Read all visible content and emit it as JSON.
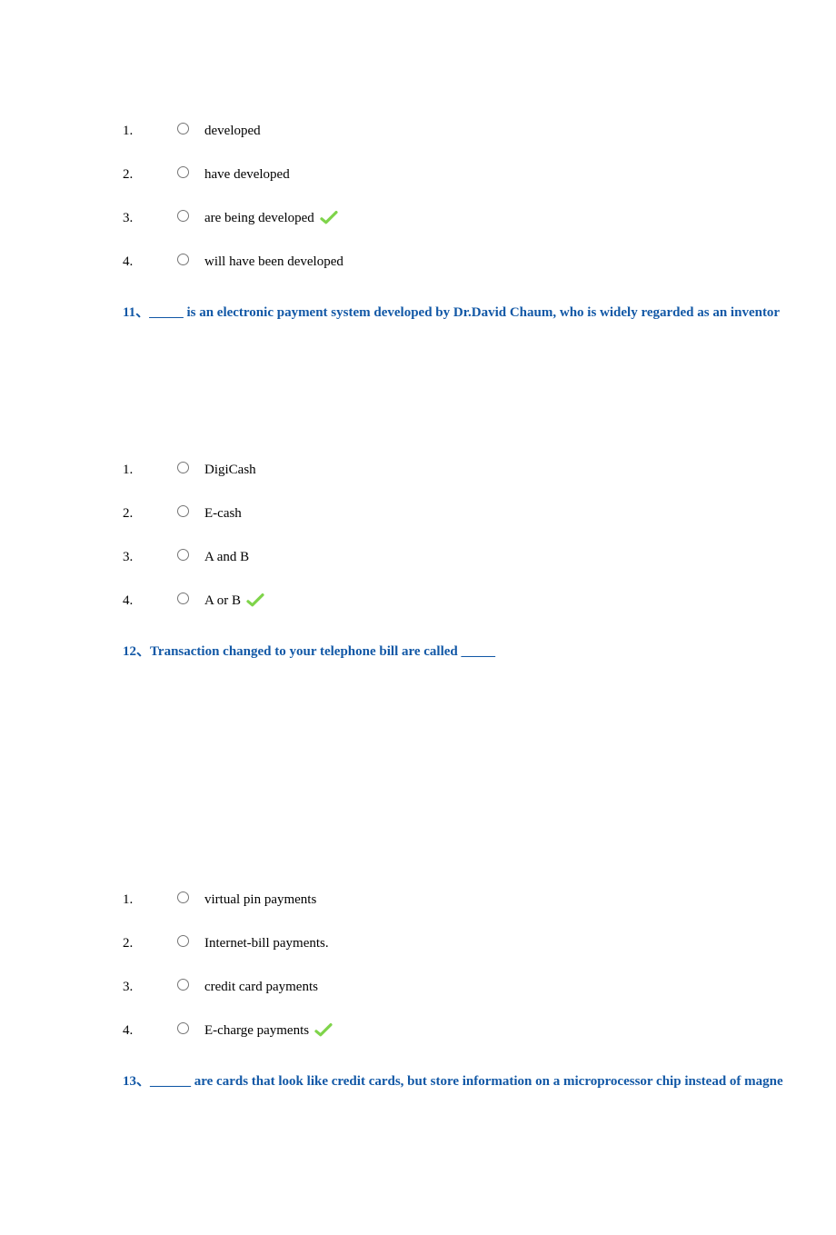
{
  "q10": {
    "options": [
      {
        "num": "1.",
        "text": "developed",
        "correct": false
      },
      {
        "num": "2.",
        "text": "have developed",
        "correct": false
      },
      {
        "num": "3.",
        "text": "are being developed",
        "correct": true
      },
      {
        "num": "4.",
        "text": "will have been developed",
        "correct": false
      }
    ]
  },
  "q11": {
    "number": "11、",
    "blank": "_____",
    "text": " is an electronic payment system developed by Dr.David Chaum, who is widely regarded as an inventor",
    "options": [
      {
        "num": "1.",
        "text": "DigiCash",
        "correct": false
      },
      {
        "num": "2.",
        "text": "E-cash",
        "correct": false
      },
      {
        "num": "3.",
        "text": "A and B",
        "correct": false
      },
      {
        "num": "4.",
        "text": "A or B",
        "correct": true
      }
    ]
  },
  "q12": {
    "number": "12、",
    "text_before": "Transaction changed to your telephone bill are called ",
    "blank": "_____",
    "gap_after": 240,
    "options": [
      {
        "num": "1.",
        "text": "virtual pin payments",
        "correct": false
      },
      {
        "num": "2.",
        "text": "Internet-bill payments.",
        "correct": false
      },
      {
        "num": "3.",
        "text": "credit card payments",
        "correct": false
      },
      {
        "num": "4.",
        "text": "E-charge payments",
        "correct": true
      }
    ]
  },
  "q13": {
    "number": "13、",
    "blank": "______",
    "text": " are cards that look like credit cards, but store information on a microprocessor chip instead of magne"
  }
}
